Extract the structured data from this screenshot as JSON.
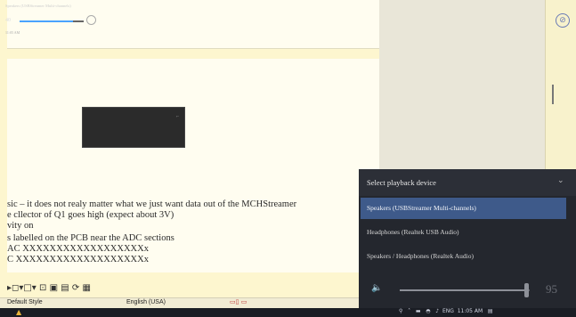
{
  "document": {
    "lines": [
      {
        "text": "sic – it does not realy matter what we just want data out of the MCHStreamer"
      },
      {
        "text": "e cllector of Q1 goes high (expect about 3V)"
      },
      {
        "text": "vity on"
      },
      {
        "text": "s labelled on the PCB near the ADC sections"
      },
      {
        "text": "AC XXXXXXXXXXXXXXXXXXx"
      },
      {
        "text": "C XXXXXXXXXXXXXXXXXXXx"
      }
    ]
  },
  "mini_popup": {
    "title": "Speakers (USBStreamer Multi-channels)",
    "volume": "40",
    "volume_level": 0.85,
    "status": "11:05 AM"
  },
  "statusbar": {
    "style": "Default Style",
    "language": "English (USA)"
  },
  "flyout": {
    "title": "Select playback device",
    "devices": [
      "Speakers (USBStreamer Multi-channels)",
      "Headphones (Realtek USB Audio)",
      "Speakers / Headphones (Realtek Audio)"
    ],
    "selected_index": 0,
    "volume": "95",
    "volume_level": 0.95
  },
  "tray": {
    "language": "ENG",
    "time": "11:05 AM"
  },
  "colors": {
    "flyout_bg": "#24272e",
    "selected_device": "#3e5a8a",
    "document_bg": "#fdf6cf"
  }
}
